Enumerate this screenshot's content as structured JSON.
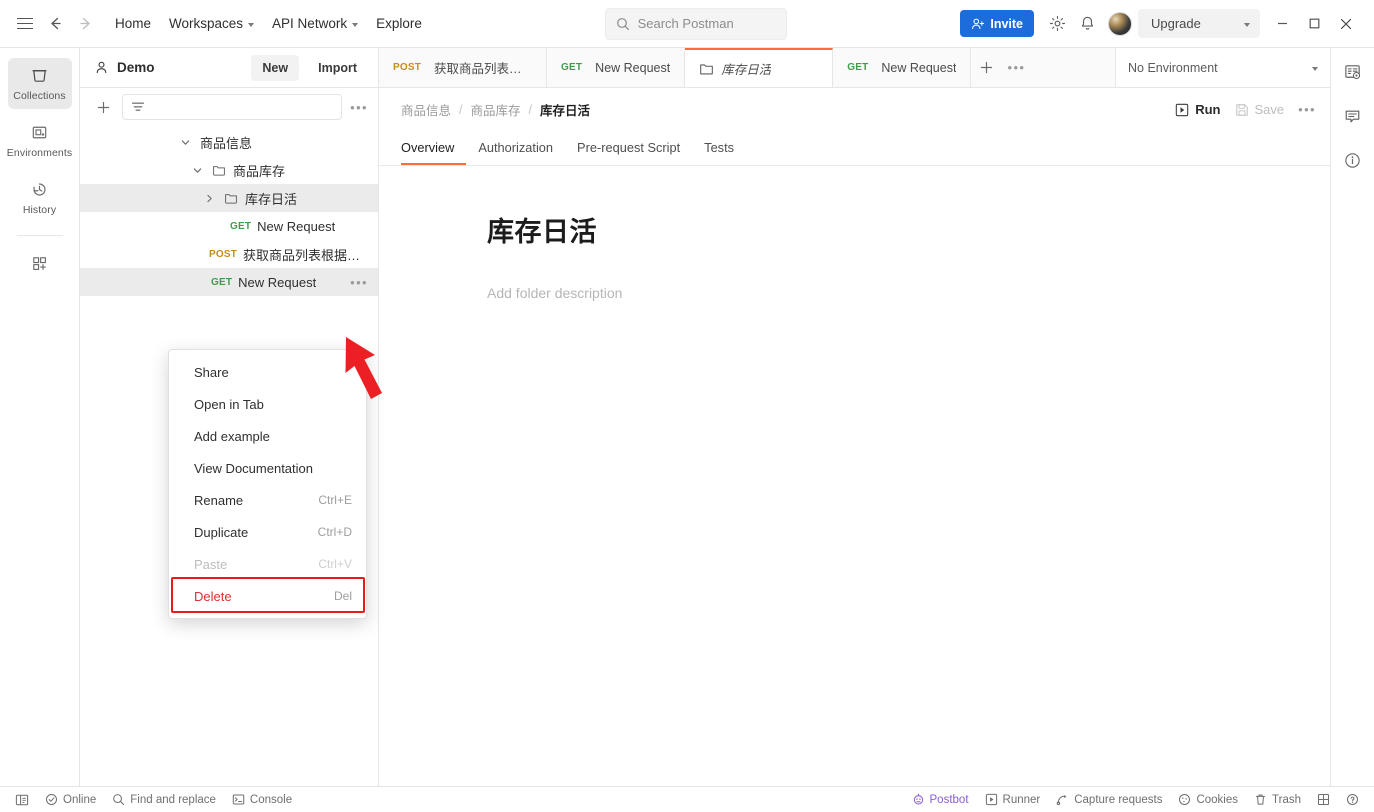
{
  "header": {
    "nav": [
      {
        "label": "Home",
        "has_caret": false
      },
      {
        "label": "Workspaces",
        "has_caret": true
      },
      {
        "label": "API Network",
        "has_caret": true
      },
      {
        "label": "Explore",
        "has_caret": false
      }
    ],
    "search_placeholder": "Search Postman",
    "invite_label": "Invite",
    "upgrade_label": "Upgrade",
    "icons": {
      "menu": "hamburger-icon",
      "back": "back-arrow-icon",
      "forward": "forward-arrow-icon",
      "settings": "gear-icon",
      "notifications": "bell-icon",
      "minimize": "minimize-icon",
      "maximize": "maximize-icon",
      "close": "close-icon"
    }
  },
  "rail": {
    "items": [
      {
        "label": "Collections",
        "icon": "collections-icon",
        "active": true
      },
      {
        "label": "Environments",
        "icon": "environments-icon",
        "active": false
      },
      {
        "label": "History",
        "icon": "history-icon",
        "active": false
      }
    ],
    "add_label": "",
    "add_icon": "add-module-icon"
  },
  "sidebar": {
    "workspace_name": "Demo",
    "new_label": "New",
    "import_label": "Import",
    "filter_placeholder": "",
    "tree": [
      {
        "label": "商品信息",
        "type": "collection",
        "depth": 0,
        "expanded": true,
        "highlight": false,
        "method": ""
      },
      {
        "label": "商品库存",
        "type": "folder",
        "depth": 1,
        "expanded": true,
        "highlight": false,
        "method": ""
      },
      {
        "label": "库存日活",
        "type": "folder",
        "depth": 2,
        "expanded": false,
        "highlight": true,
        "method": ""
      },
      {
        "label": "New Request",
        "type": "request",
        "depth": 2,
        "expanded": false,
        "highlight": false,
        "method": "GET"
      },
      {
        "label": "获取商品列表根据商品名称",
        "type": "request",
        "depth": 1,
        "expanded": false,
        "highlight": false,
        "method": "POST"
      },
      {
        "label": "New Request",
        "type": "request",
        "depth": 1,
        "expanded": false,
        "highlight": true,
        "method": "GET"
      }
    ]
  },
  "context_menu": {
    "items": [
      {
        "label": "Share",
        "shortcut": "",
        "disabled": false,
        "danger": false
      },
      {
        "label": "Open in Tab",
        "shortcut": "",
        "disabled": false,
        "danger": false
      },
      {
        "label": "Add example",
        "shortcut": "",
        "disabled": false,
        "danger": false
      },
      {
        "label": "View Documentation",
        "shortcut": "",
        "disabled": false,
        "danger": false
      },
      {
        "label": "Rename",
        "shortcut": "Ctrl+E",
        "disabled": false,
        "danger": false
      },
      {
        "label": "Duplicate",
        "shortcut": "Ctrl+D",
        "disabled": false,
        "danger": false
      },
      {
        "label": "Paste",
        "shortcut": "Ctrl+V",
        "disabled": true,
        "danger": false
      },
      {
        "label": "Delete",
        "shortcut": "Del",
        "disabled": false,
        "danger": true
      }
    ],
    "highlight_color": "#e81b1b",
    "danger_color": "#e02f2f"
  },
  "tabs": {
    "items": [
      {
        "method": "POST",
        "label": "获取商品列表根据商品名",
        "active": false,
        "icon": ""
      },
      {
        "method": "GET",
        "label": "New Request",
        "active": false,
        "icon": ""
      },
      {
        "method": "",
        "label": "库存日活",
        "active": true,
        "icon": "folder-icon"
      },
      {
        "method": "GET",
        "label": "New Request",
        "active": false,
        "icon": ""
      }
    ],
    "add_tab_icon": "plus-icon",
    "more_icon": "more-icon",
    "environment": "No Environment"
  },
  "main": {
    "breadcrumb": [
      "商品信息",
      "商品库存",
      "库存日活"
    ],
    "run_label": "Run",
    "save_label": "Save",
    "subtabs": [
      {
        "label": "Overview",
        "active": true
      },
      {
        "label": "Authorization",
        "active": false
      },
      {
        "label": "Pre-request Script",
        "active": false
      },
      {
        "label": "Tests",
        "active": false
      }
    ],
    "folder_title": "库存日活",
    "folder_description_placeholder": "Add folder description"
  },
  "right_rail": {
    "items": [
      {
        "icon": "environment-quick-look-icon"
      },
      {
        "icon": "comment-icon"
      },
      {
        "icon": "info-icon"
      }
    ]
  },
  "statusbar": {
    "left": [
      {
        "label": "",
        "icon": "sidebar-toggle-icon"
      },
      {
        "label": "Online",
        "icon": "online-icon"
      },
      {
        "label": "Find and replace",
        "icon": "search-icon"
      },
      {
        "label": "Console",
        "icon": "console-icon"
      }
    ],
    "right": [
      {
        "label": "Postbot",
        "icon": "postbot-icon",
        "accent": "#8a5cd6"
      },
      {
        "label": "Runner",
        "icon": "runner-icon",
        "accent": ""
      },
      {
        "label": "Capture requests",
        "icon": "capture-icon",
        "accent": ""
      },
      {
        "label": "Cookies",
        "icon": "cookies-icon",
        "accent": ""
      },
      {
        "label": "Trash",
        "icon": "trash-icon",
        "accent": ""
      },
      {
        "label": "",
        "icon": "layout-icon",
        "accent": ""
      },
      {
        "label": "",
        "icon": "help-icon",
        "accent": ""
      }
    ]
  },
  "annotations": {
    "arrow_color": "#e81b1b",
    "arrow_target": "row-more-options-button"
  },
  "theme": {
    "accent_orange": "#ff6c37",
    "invite_blue": "#1c6ddb",
    "get_green": "#3f9c4d",
    "post_orange": "#c98a1e"
  }
}
